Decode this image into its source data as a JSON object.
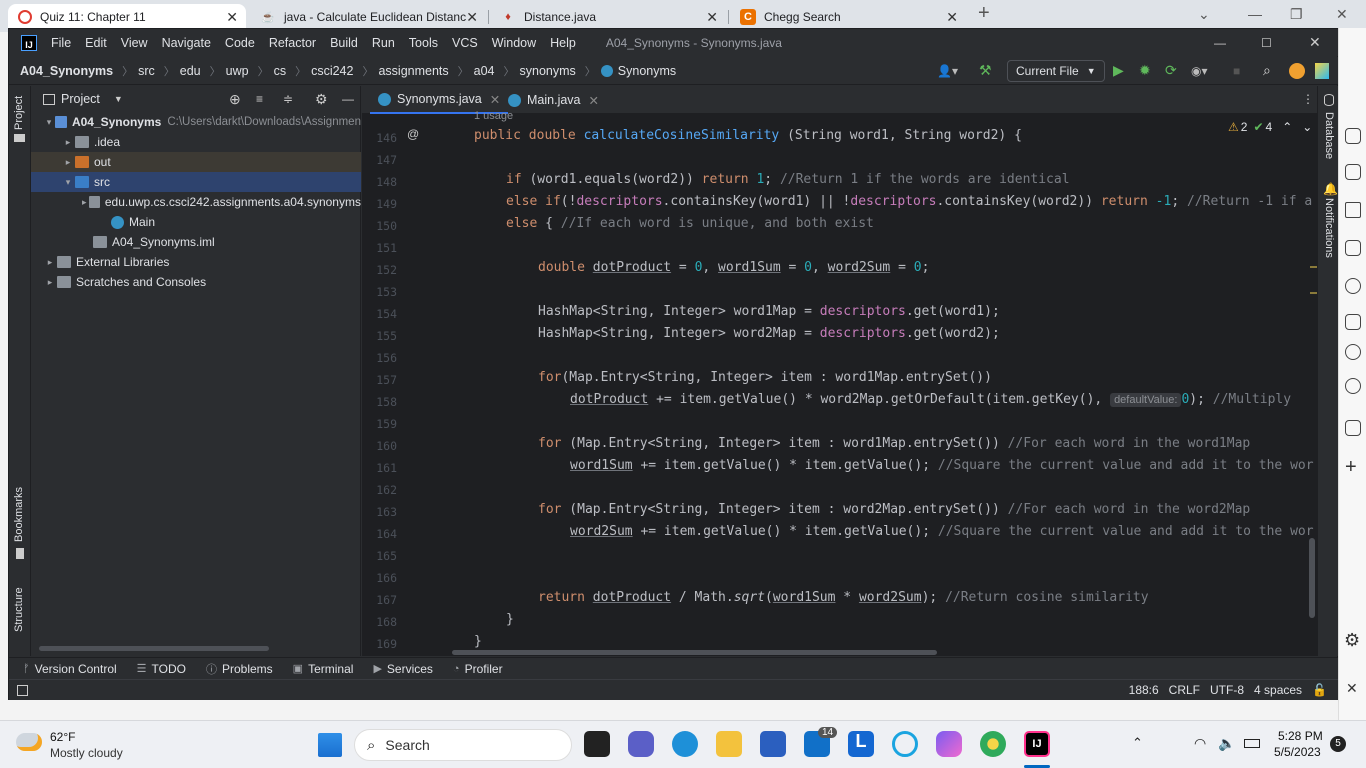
{
  "browser": {
    "tabs": [
      {
        "label": "Quiz 11: Chapter 11",
        "icon": "canvas-icon"
      },
      {
        "label": "java - Calculate Euclidean Distanc",
        "icon": "stackoverflow-icon"
      },
      {
        "label": "Distance.java",
        "icon": "github-icon"
      },
      {
        "label": "Chegg Search",
        "icon": "chegg-icon"
      }
    ],
    "new_tab": "+"
  },
  "ide": {
    "menu": [
      "File",
      "Edit",
      "View",
      "Navigate",
      "Code",
      "Refactor",
      "Build",
      "Run",
      "Tools",
      "VCS",
      "Window",
      "Help"
    ],
    "title": "A04_Synonyms - Synonyms.java",
    "breadcrumbs": [
      "A04_Synonyms",
      "src",
      "edu",
      "uwp",
      "cs",
      "csci242",
      "assignments",
      "a04",
      "synonyms",
      "Synonyms"
    ],
    "run_config": "Current File",
    "project_panel": {
      "title": "Project",
      "rows": [
        {
          "label": "A04_Synonyms",
          "extra": "C:\\Users\\darkt\\Downloads\\Assignmen",
          "indent": 0,
          "arrow": "▾",
          "bold": true
        },
        {
          "label": ".idea",
          "indent": 1,
          "arrow": "▸"
        },
        {
          "label": "out",
          "indent": 1,
          "arrow": "▸"
        },
        {
          "label": "src",
          "indent": 1,
          "arrow": "▾"
        },
        {
          "label": "edu.uwp.cs.csci242.assignments.a04.synonyms",
          "indent": 2,
          "arrow": "▸"
        },
        {
          "label": "Main",
          "indent": 3,
          "arrow": ""
        },
        {
          "label": "A04_Synonyms.iml",
          "indent": 2,
          "arrow": ""
        },
        {
          "label": "External Libraries",
          "indent": 0,
          "arrow": "▸"
        },
        {
          "label": "Scratches and Consoles",
          "indent": 0,
          "arrow": "▸"
        }
      ]
    },
    "left_strip": [
      "Project",
      "Bookmarks",
      "Structure"
    ],
    "right_strip": [
      "Database",
      "Notifications"
    ],
    "editor_tabs": [
      "Synonyms.java",
      "Main.java"
    ],
    "usage_hint": "1 usage",
    "inspections": {
      "warnings": "2",
      "ok": "4"
    },
    "param_hint": "defaultValue:",
    "lines": [
      {
        "n": "146",
        "code": "public double calculateCosineSimilarity (String word1, String word2) {"
      },
      {
        "n": "147",
        "code": ""
      },
      {
        "n": "148",
        "code": "if (word1.equals(word2)) return 1; //Return 1 if the words are identical"
      },
      {
        "n": "149",
        "code": "else if(!descriptors.containsKey(word1) || !descriptors.containsKey(word2)) return -1; //Return -1 if a"
      },
      {
        "n": "150",
        "code": "else { //If each word is unique, and both exist"
      },
      {
        "n": "151",
        "code": ""
      },
      {
        "n": "152",
        "code": "double dotProduct = 0, word1Sum = 0, word2Sum = 0;"
      },
      {
        "n": "153",
        "code": ""
      },
      {
        "n": "154",
        "code": "HashMap<String, Integer> word1Map = descriptors.get(word1);"
      },
      {
        "n": "155",
        "code": "HashMap<String, Integer> word2Map = descriptors.get(word2);"
      },
      {
        "n": "156",
        "code": ""
      },
      {
        "n": "157",
        "code": "for(Map.Entry<String, Integer> item : word1Map.entrySet())"
      },
      {
        "n": "158",
        "code": "dotProduct += item.getValue() * word2Map.getOrDefault(item.getKey(), defaultValue: 0); //Multiply"
      },
      {
        "n": "159",
        "code": ""
      },
      {
        "n": "160",
        "code": "for (Map.Entry<String, Integer> item : word1Map.entrySet()) //For each word in the word1Map"
      },
      {
        "n": "161",
        "code": "word1Sum += item.getValue() * item.getValue(); //Square the current value and add it to the wor"
      },
      {
        "n": "162",
        "code": ""
      },
      {
        "n": "163",
        "code": "for (Map.Entry<String, Integer> item : word2Map.entrySet()) //For each word in the word2Map"
      },
      {
        "n": "164",
        "code": "word2Sum += item.getValue() * item.getValue(); //Square the current value and add it to the wor"
      },
      {
        "n": "165",
        "code": ""
      },
      {
        "n": "166",
        "code": ""
      },
      {
        "n": "167",
        "code": "return dotProduct / Math.sqrt(word1Sum * word2Sum); //Return cosine similarity"
      },
      {
        "n": "168",
        "code": "}"
      },
      {
        "n": "169",
        "code": "}"
      }
    ],
    "bottom_tools": [
      "Version Control",
      "TODO",
      "Problems",
      "Terminal",
      "Services",
      "Profiler"
    ],
    "status": {
      "position": "188:6",
      "line_sep": "CRLF",
      "encoding": "UTF-8",
      "indent": "4 spaces"
    }
  },
  "taskbar": {
    "weather_temp": "62°F",
    "weather_desc": "Mostly cloudy",
    "search": "Search",
    "time": "5:28 PM",
    "date": "5/5/2023",
    "notif_count": "5",
    "mail_badge": "14"
  }
}
